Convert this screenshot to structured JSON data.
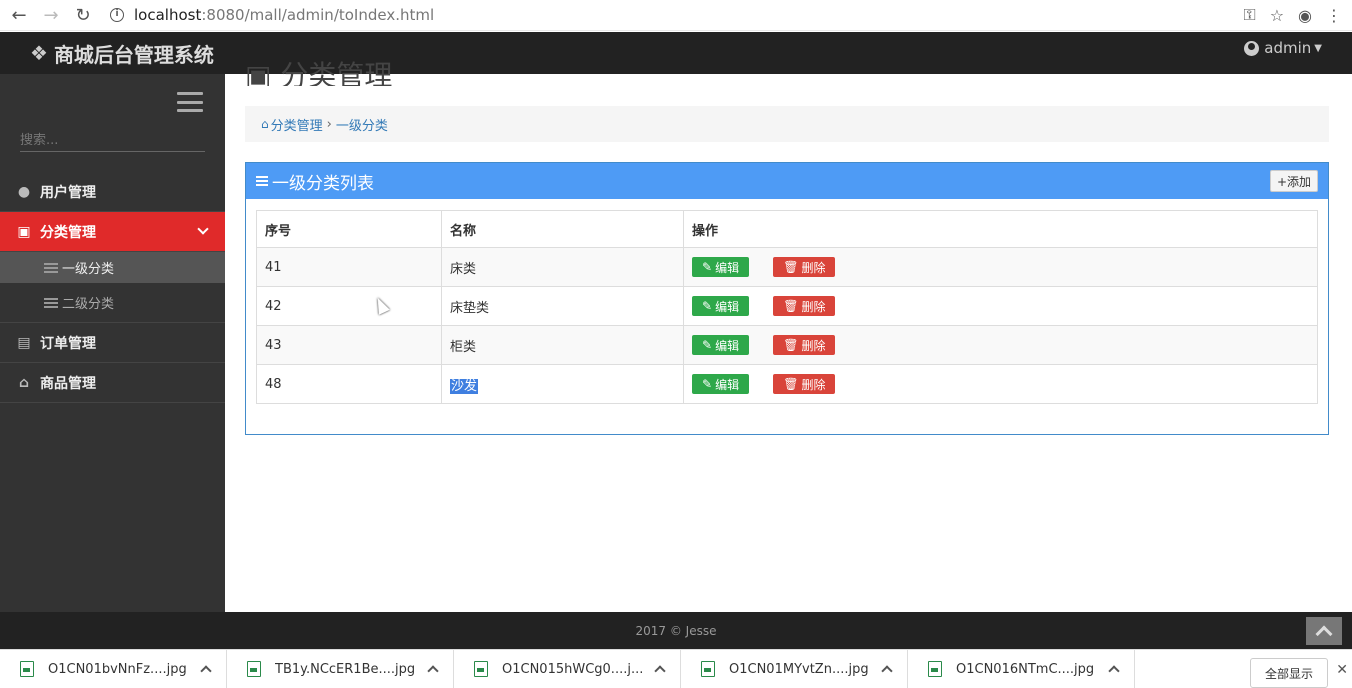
{
  "browser": {
    "url_host": "localhost",
    "url_rest": ":8080/mall/admin/toIndex.html"
  },
  "topbar": {
    "brand": "商城后台管理系统",
    "user": "admin"
  },
  "sidebar": {
    "search_placeholder": "搜索...",
    "items": [
      {
        "label": "用户管理",
        "icon": "user-circle-icon"
      },
      {
        "label": "分类管理",
        "icon": "category-icon",
        "active": true,
        "children": [
          {
            "label": "一级分类",
            "selected": true
          },
          {
            "label": "二级分类"
          }
        ]
      },
      {
        "label": "订单管理",
        "icon": "file-icon"
      },
      {
        "label": "商品管理",
        "icon": "shopping-bag-icon"
      }
    ]
  },
  "main": {
    "page_title": "分类管理",
    "breadcrumb": [
      "分类管理",
      "一级分类"
    ],
    "panel_title": "一级分类列表",
    "add_label": "+添加",
    "table": {
      "headers": [
        "序号",
        "名称",
        "操作"
      ],
      "rows": [
        {
          "id": "41",
          "name": "床类"
        },
        {
          "id": "42",
          "name": "床垫类"
        },
        {
          "id": "43",
          "name": "柜类"
        },
        {
          "id": "48",
          "name": "沙发"
        }
      ],
      "edit_label": "编辑",
      "delete_label": "删除"
    }
  },
  "footer": {
    "text": "2017 © Jesse"
  },
  "downloads": {
    "items": [
      "O1CN01bvNnFz....jpg",
      "TB1y.NCcER1Be....jpg",
      "O1CN015hWCg0....j...",
      "O1CN01MYvtZn....jpg",
      "O1CN016NTmC....jpg"
    ],
    "show_all": "全部显示"
  }
}
